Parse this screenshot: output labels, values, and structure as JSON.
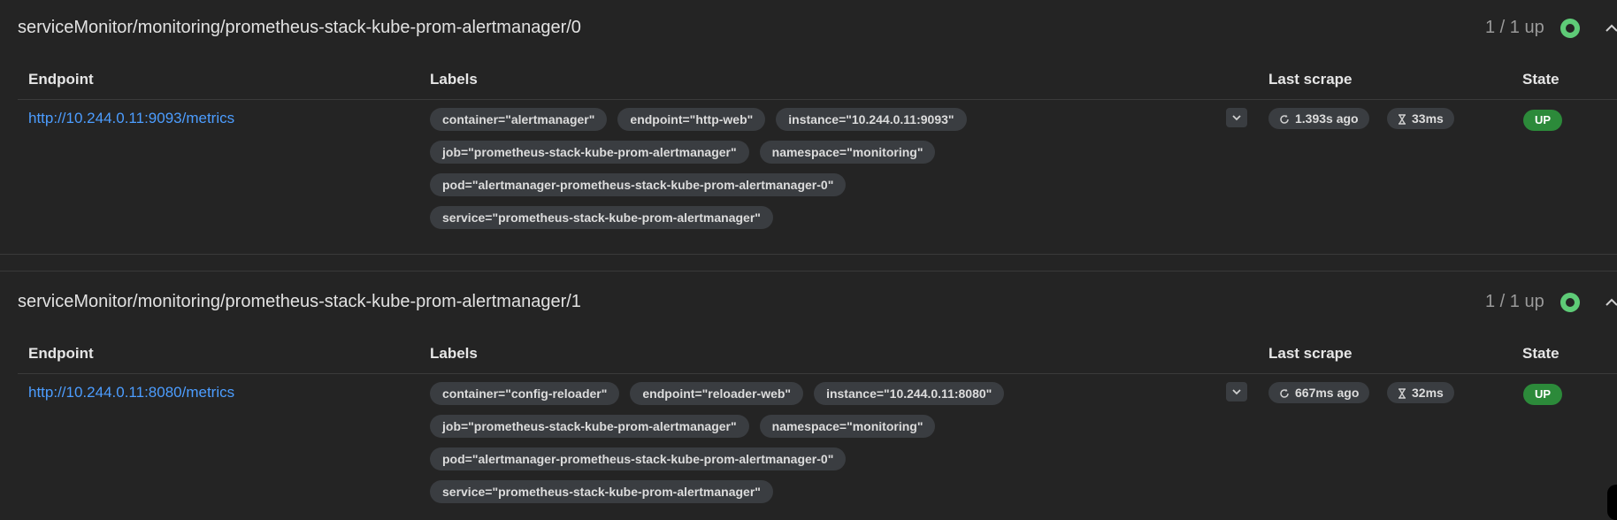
{
  "pools": [
    {
      "title": "serviceMonitor/monitoring/prometheus-stack-kube-prom-alertmanager/0",
      "up_count": "1 / 1 up",
      "columns": {
        "endpoint": "Endpoint",
        "labels": "Labels",
        "last_scrape": "Last scrape",
        "state": "State"
      },
      "target": {
        "endpoint": "http://10.244.0.11:9093/metrics",
        "label_rows": [
          [
            "container=\"alertmanager\"",
            "endpoint=\"http-web\"",
            "instance=\"10.244.0.11:9093\""
          ],
          [
            "job=\"prometheus-stack-kube-prom-alertmanager\"",
            "namespace=\"monitoring\""
          ],
          [
            "pod=\"alertmanager-prometheus-stack-kube-prom-alertmanager-0\""
          ],
          [
            "service=\"prometheus-stack-kube-prom-alertmanager\""
          ]
        ],
        "last_scrape_ago": "1.393s ago",
        "scrape_duration": "33ms",
        "state": "UP"
      }
    },
    {
      "title": "serviceMonitor/monitoring/prometheus-stack-kube-prom-alertmanager/1",
      "up_count": "1 / 1 up",
      "columns": {
        "endpoint": "Endpoint",
        "labels": "Labels",
        "last_scrape": "Last scrape",
        "state": "State"
      },
      "target": {
        "endpoint": "http://10.244.0.11:8080/metrics",
        "label_rows": [
          [
            "container=\"config-reloader\"",
            "endpoint=\"reloader-web\"",
            "instance=\"10.244.0.11:8080\""
          ],
          [
            "job=\"prometheus-stack-kube-prom-alertmanager\"",
            "namespace=\"monitoring\""
          ],
          [
            "pod=\"alertmanager-prometheus-stack-kube-prom-alertmanager-0\""
          ],
          [
            "service=\"prometheus-stack-kube-prom-alertmanager\""
          ]
        ],
        "last_scrape_ago": "667ms ago",
        "scrape_duration": "32ms",
        "state": "UP"
      }
    }
  ],
  "icons": {
    "health": "health-status-icon",
    "collapse": "chevron-up-icon",
    "expand": "chevron-down-icon",
    "refresh": "refresh-icon",
    "duration": "hourglass-icon"
  },
  "colors": {
    "background": "#242424",
    "link": "#4c9dff",
    "healthy": "#5ecb77",
    "up_badge": "#2c8a3a",
    "label_badge": "#3a3d41"
  }
}
